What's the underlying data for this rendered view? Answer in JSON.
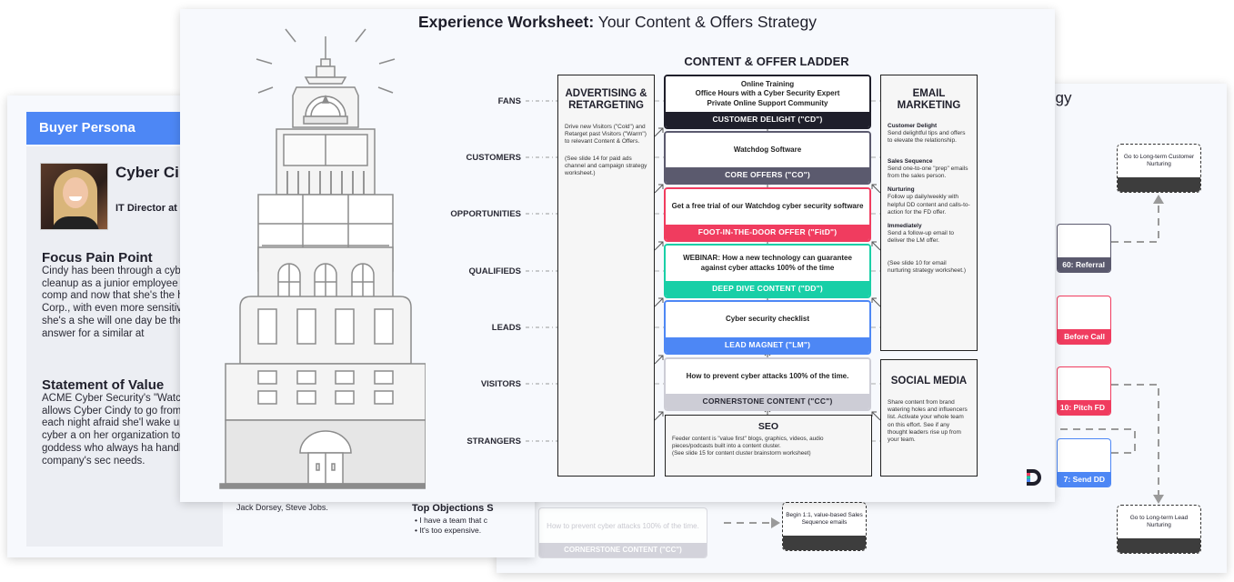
{
  "persona_slide": {
    "header": "Buyer Persona",
    "name": "Cyber Cindy",
    "role": "IT Director at",
    "pain_heading": "Focus Pain Point",
    "pain_text": "Cindy has been through a cyb attack cleanup as a junior employee at a previous comp and now that she's the head at XYZ Corp., with even more sensitive data and IP, she's a she will one day be the one w has to answer for a similar at",
    "value_heading": "Statement of Value",
    "value_text": "ACME Cyber Security's \"Watchdog\" software allows Cyber Cindy to go from falling asleep each night afraid she'l wake up to news of a cyber a on her organization to feeling an IT goddess who always ha handle on her company's sec needs.",
    "influencers_tail": "Jack Dorsey, Steve Jobs.",
    "objections_heading": "Top Objections S",
    "objections": [
      "I have a team that c",
      "It's too expensive."
    ]
  },
  "nurture_slide": {
    "title_fragment": "g Strategy",
    "cards": [
      {
        "label": "60: Referral",
        "color": "#5b5a6e"
      },
      {
        "label": "Before Call",
        "color": "#f03c5f"
      },
      {
        "label": "10: Pitch FD",
        "color": "#f03c5f"
      },
      {
        "label": "7: Send DD",
        "color": "#4d87f5"
      }
    ],
    "dash_boxes": [
      {
        "text": "Go to Long-term Customer Nurturing"
      },
      {
        "text": "Go to Long-term Lead Nurturing"
      },
      {
        "text": "Begin 1:1, value-based Sales Sequence emails"
      }
    ],
    "ghost_card": {
      "text": "How to prevent cyber attacks 100% of the time.",
      "label": "CORNERSTONE CONTENT (\"CC\")"
    }
  },
  "main_slide": {
    "title_bold": "Experience Worksheet:",
    "title_rest": " Your Content & Offers Strategy",
    "ladder_title": "CONTENT & OFFER LADDER",
    "stages": [
      "FANS",
      "CUSTOMERS",
      "OPPORTUNITIES",
      "QUALIFIEDS",
      "LEADS",
      "VISITORS",
      "STRANGERS"
    ],
    "advertising": {
      "heading": "ADVERTISING & RETARGETING",
      "text1": "Drive new Visitors (\"Cold\") and Retarget past Visitors (\"Warm\") to relevant Content & Offers.",
      "text2": "(See slide 14 for paid ads channel and campaign strategy worksheet.)"
    },
    "email": {
      "heading": "EMAIL MARKETING",
      "items": [
        {
          "title": "Customer Delight",
          "text": "Send delightful tips and offers to elevate the relationship."
        },
        {
          "title": "Sales Sequence",
          "text": "Send one-to-one \"prep\" emails from the sales person."
        },
        {
          "title": "Nurturing",
          "text": "Follow up daily/weekly with helpful DD content and calls-to-action for the FD offer."
        },
        {
          "title": "Immediately",
          "text": "Send a follow-up email to deliver the LM offer."
        }
      ],
      "footnote": "(See slide 10 for email nurturing strategy worksheet.)"
    },
    "social": {
      "heading": "SOCIAL MEDIA",
      "text": "Share content from brand watering holes and influencers list. Activate your whole team on this effort. See if any thought leaders rise up from your team."
    },
    "rungs": [
      {
        "content": "Online Training\nOffice Hours with a Cyber Security Expert\nPrivate Online Support Community",
        "label": "CUSTOMER DELIGHT (\"CD\")",
        "color": "#1f1f2b"
      },
      {
        "content": "Watchdog Software",
        "label": "CORE OFFERS (\"CO\")",
        "color": "#5b5a6e"
      },
      {
        "content": "Get a free trial of our Watchdog cyber security software",
        "label": "FOOT-IN-THE-DOOR OFFER (\"FitD\")",
        "color": "#f03c5f"
      },
      {
        "content": "WEBINAR: How a new technology can guarantee against cyber attacks 100% of the time",
        "label": "DEEP DIVE CONTENT (\"DD\")",
        "color": "#18cfa7"
      },
      {
        "content": "Cyber security checklist",
        "label": "LEAD MAGNET (\"LM\")",
        "color": "#4d87f5"
      },
      {
        "content": "How to prevent cyber attacks 100% of the time.",
        "label": "CORNERSTONE CONTENT (\"CC\")",
        "color": "#cdcdd6"
      }
    ],
    "seo": {
      "heading": "SEO",
      "text": "Feeder content is \"value first\" blogs, graphics, videos, audio pieces/podcasts built into a content cluster.\n(See slide 15 for content cluster brainstorm worksheet)"
    },
    "brand_colors": [
      "#f03c5f",
      "#18cfa7",
      "#4d87f5"
    ]
  }
}
